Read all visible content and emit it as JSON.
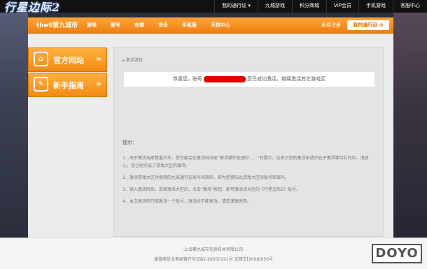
{
  "brand": {
    "logo_text": "行星边际2"
  },
  "top_links": [
    "我的通行证 ▾",
    "九城游戏",
    "积分商城",
    "VIP会员",
    "手机游戏",
    "客服中心"
  ],
  "nav": {
    "brand": "the9第九城市",
    "items": [
      "游戏",
      "账号",
      "充值",
      "安全",
      "手机版",
      "天技中心"
    ],
    "register": "免费注册",
    "pass_button": "我的通行证 ⊙"
  },
  "sidebar": [
    {
      "label": "官方网站",
      "icon": "home-icon"
    },
    {
      "label": "新手指南",
      "icon": "guide-icon"
    }
  ],
  "content": {
    "breadcrumb": "激活游戏",
    "notice_prefix": "恭喜您，账号",
    "notice_suffix": "您已成功激活，继续激活其它游戏区",
    "tips_title": "提示：",
    "tips": [
      "1、由于激活玩家数量众多，您可能会在激活时出现“激活操作处理中......”的提示，这表示您的激活由请正处于激活等待队列中。请放心，您已经完成了游戏大区的激活。",
      "2、激活游戏大区时使用的九城通行证账号和密码，即为您登陆此游戏大区的账号和密码。",
      "3、输入激活码后，选择激活大区后，点击“激活”按钮，即可激活该大区的《行星边际2》账号。",
      "4、本次激活码只能激活一个账号，激活后不能更改，请您谨慎使用。"
    ]
  },
  "footer": {
    "line1": "-上海第九城市信息技术有限公司-",
    "line2": "增值电信业务经营许可证B2-20050191号 文网文[2008]056号"
  },
  "watermark": "DOYO"
}
